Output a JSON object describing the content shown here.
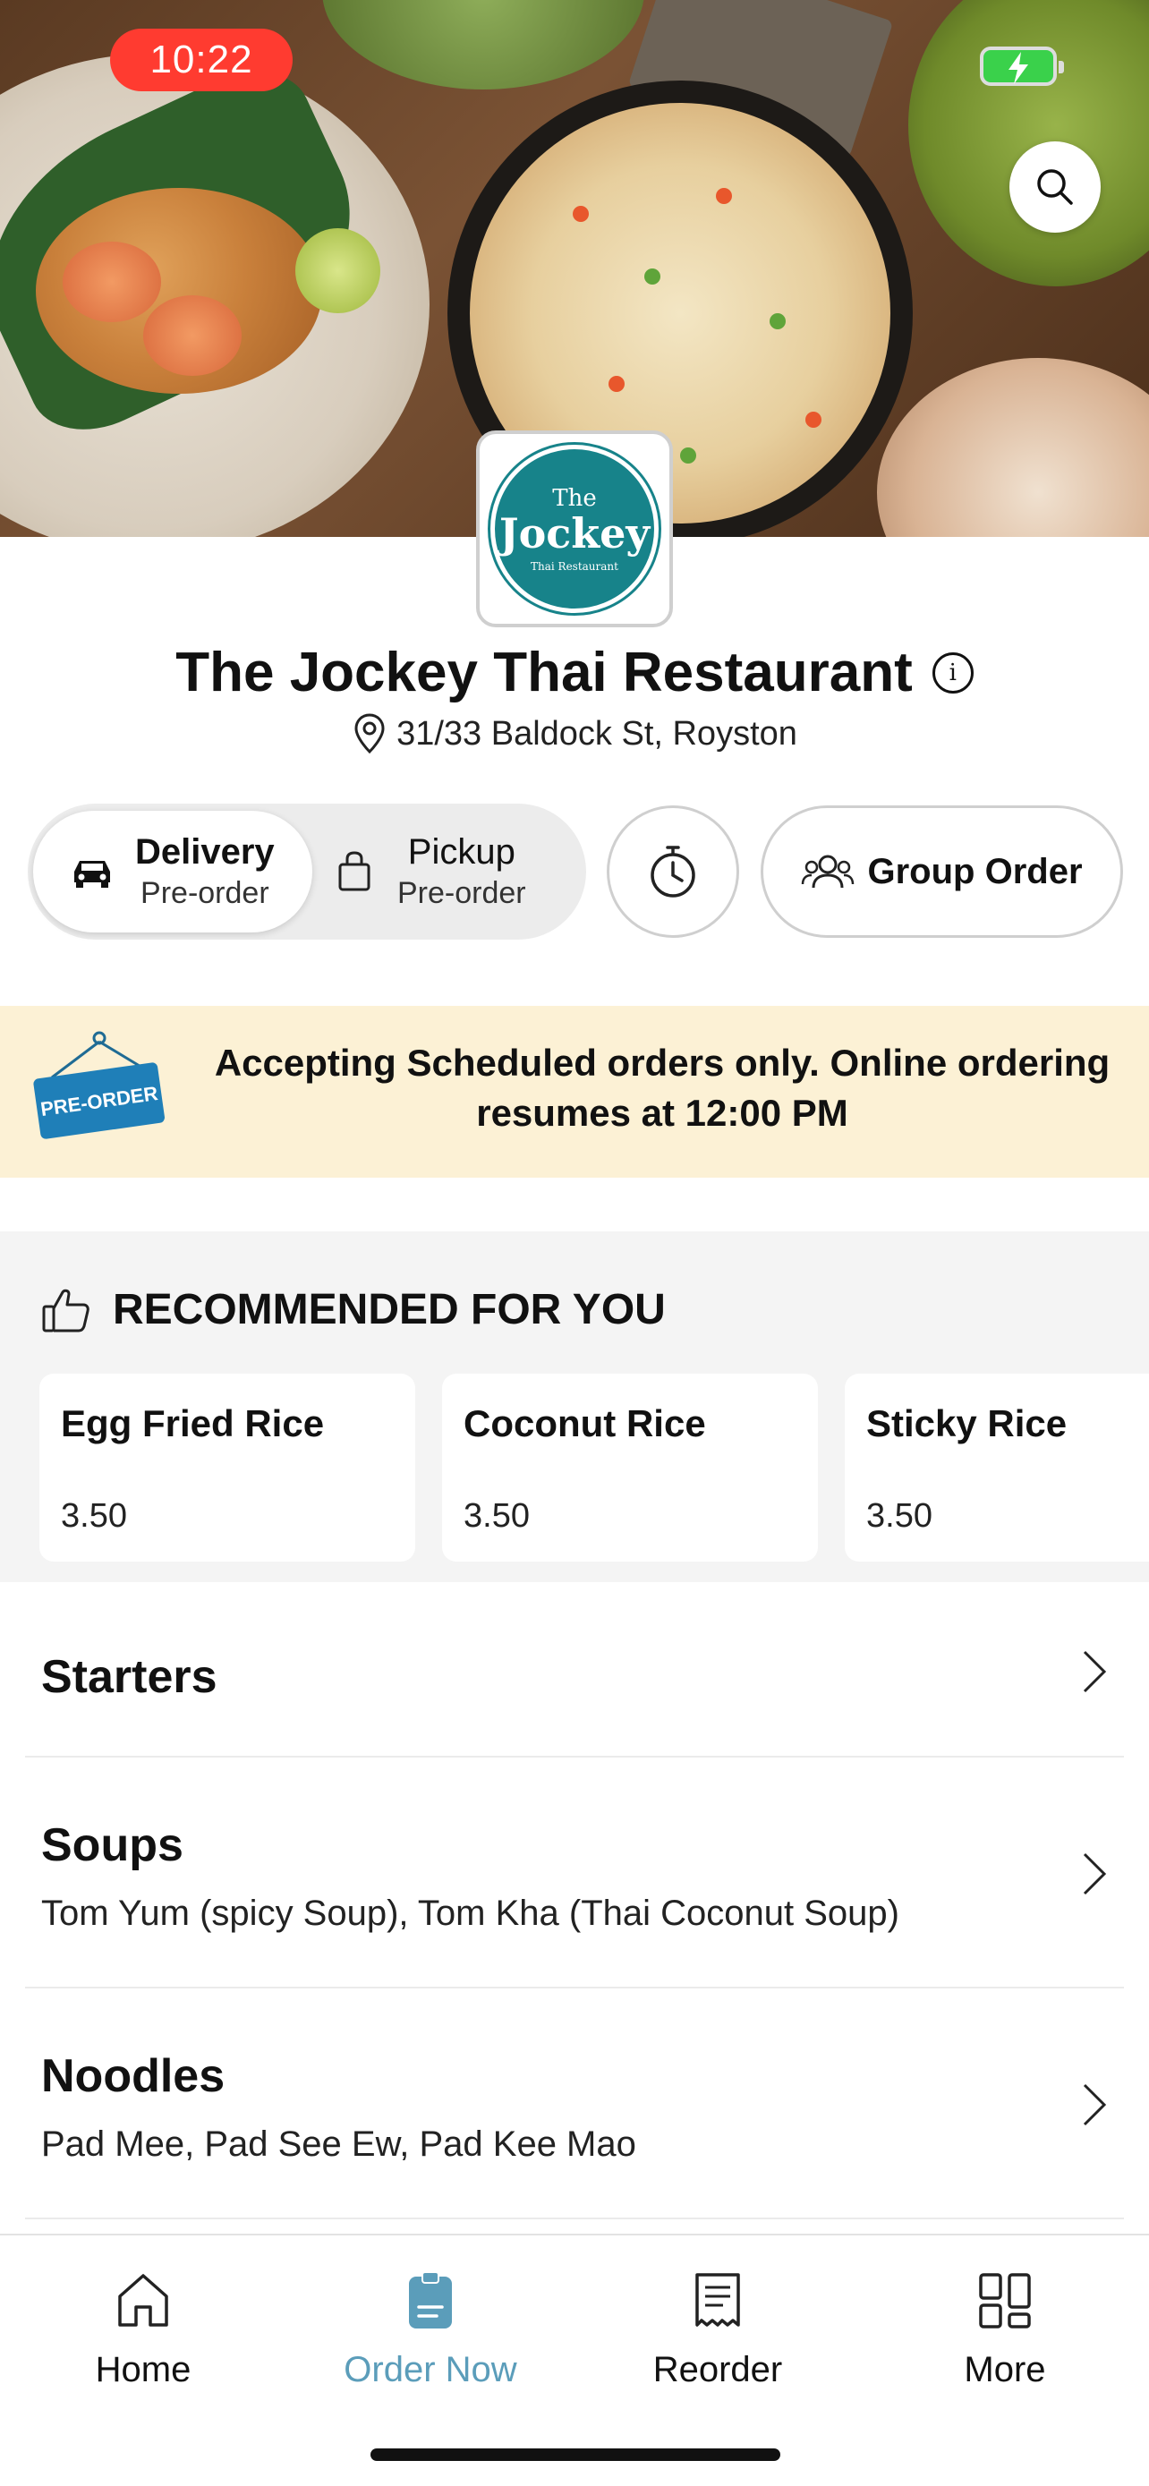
{
  "status_bar": {
    "time": "10:22"
  },
  "restaurant": {
    "name": "The Jockey Thai Restaurant",
    "address": "31/33 Baldock St, Royston",
    "logo": {
      "line1": "The",
      "line2": "Jockey",
      "line3": "Thai Restaurant"
    }
  },
  "order_modes": {
    "delivery": {
      "label": "Delivery",
      "sublabel": "Pre-order",
      "selected": true
    },
    "pickup": {
      "label": "Pickup",
      "sublabel": "Pre-order",
      "selected": false
    },
    "group_order_label": "Group Order"
  },
  "banner": {
    "sign_text": "PRE-ORDER",
    "message": "Accepting Scheduled orders only. Online ordering resumes at 12:00 PM"
  },
  "recommended": {
    "heading": "RECOMMENDED FOR YOU",
    "items": [
      {
        "name": "Egg Fried Rice",
        "price": "3.50"
      },
      {
        "name": "Coconut Rice",
        "price": "3.50"
      },
      {
        "name": "Sticky Rice",
        "price": "3.50"
      }
    ]
  },
  "categories": [
    {
      "name": "Starters",
      "description": ""
    },
    {
      "name": "Soups",
      "description": "Tom Yum (spicy Soup), Tom Kha (Thai Coconut Soup)"
    },
    {
      "name": "Noodles",
      "description": "Pad Mee, Pad See Ew, Pad Kee Mao"
    }
  ],
  "tab_bar": {
    "tabs": [
      {
        "label": "Home",
        "icon": "home-icon",
        "active": false
      },
      {
        "label": "Order Now",
        "icon": "order-icon",
        "active": true
      },
      {
        "label": "Reorder",
        "icon": "receipt-icon",
        "active": false
      },
      {
        "label": "More",
        "icon": "grid-icon",
        "active": false
      }
    ]
  },
  "colors": {
    "accent": "#5b9dba",
    "logo_teal": "#17838a",
    "banner_bg": "#fcf1d5",
    "status_pill": "#ff3b30",
    "preorder_sign": "#1f7fb8"
  }
}
